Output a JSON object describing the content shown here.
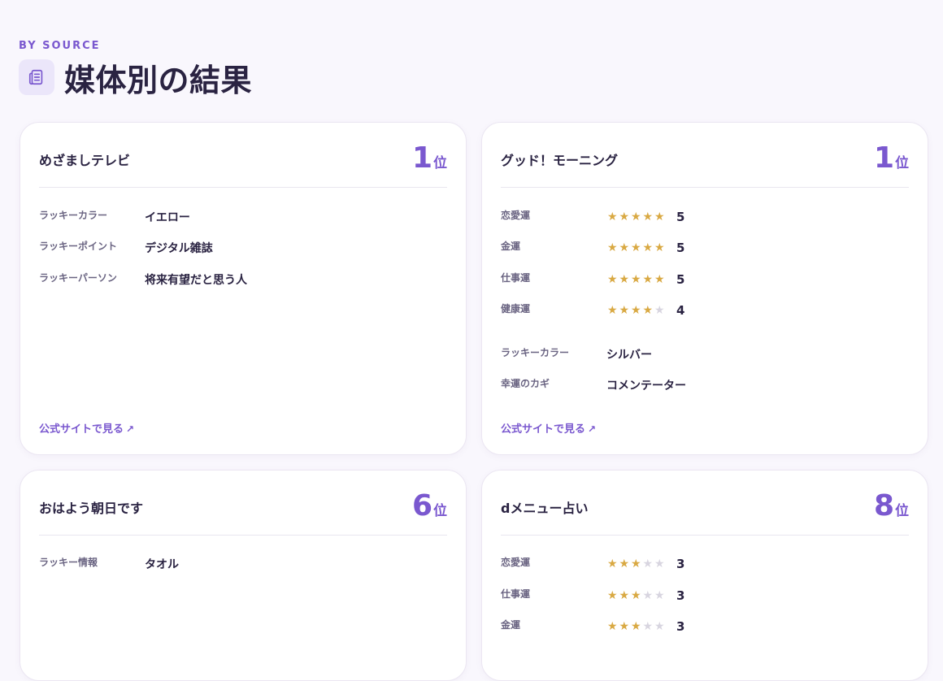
{
  "section": {
    "eyebrow": "BY SOURCE",
    "title": "媒体別の結果",
    "icon": "newspaper-icon"
  },
  "colors": {
    "accent": "#7a58cf",
    "star_on": "#d9a943",
    "star_off": "#d8d5e0",
    "background": "#f9f7fd"
  },
  "rank_unit": "位",
  "link_label": "公式サイトで見る",
  "link_icon": "external-link-icon",
  "cards": [
    {
      "name": "めざましテレビ",
      "rank": "1",
      "items": [
        {
          "label": "ラッキーカラー",
          "value": "イエロー"
        },
        {
          "label": "ラッキーポイント",
          "value": "デジタル雑誌"
        },
        {
          "label": "ラッキーパーソン",
          "value": "将来有望だと思う人"
        }
      ]
    },
    {
      "name": "グッド！モーニング",
      "rank": "1",
      "ratings": [
        {
          "label": "恋愛運",
          "score": "5",
          "stars": 5
        },
        {
          "label": "金運",
          "score": "5",
          "stars": 5
        },
        {
          "label": "仕事運",
          "score": "5",
          "stars": 5
        },
        {
          "label": "健康運",
          "score": "4",
          "stars": 4
        }
      ],
      "items": [
        {
          "label": "ラッキーカラー",
          "value": "シルバー"
        },
        {
          "label": "幸運のカギ",
          "value": "コメンテーター"
        }
      ]
    },
    {
      "name": "おはよう朝日です",
      "rank": "6",
      "items": [
        {
          "label": "ラッキー情報",
          "value": "タオル"
        }
      ]
    },
    {
      "name": "dメニュー占い",
      "rank": "8",
      "ratings": [
        {
          "label": "恋愛運",
          "score": "3",
          "stars": 3
        },
        {
          "label": "仕事運",
          "score": "3",
          "stars": 3
        },
        {
          "label": "金運",
          "score": "3",
          "stars": 3
        }
      ]
    }
  ]
}
